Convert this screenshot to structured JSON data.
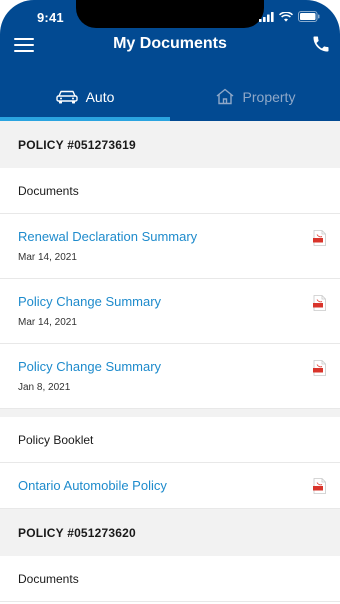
{
  "status": {
    "time": "9:41"
  },
  "header": {
    "title": "My Documents"
  },
  "tabs": [
    {
      "label": "Auto",
      "icon": "car-icon",
      "active": true
    },
    {
      "label": "Property",
      "icon": "house-icon",
      "active": false
    }
  ],
  "policies": [
    {
      "policy_label": "POLICY #051273619",
      "documents_heading": "Documents",
      "documents": [
        {
          "title": "Renewal Declaration Summary",
          "date": "Mar 14, 2021",
          "icon": "pdf-icon"
        },
        {
          "title": "Policy Change Summary",
          "date": "Mar 14, 2021",
          "icon": "pdf-icon"
        },
        {
          "title": "Policy Change Summary",
          "date": "Jan 8, 2021",
          "icon": "pdf-icon"
        }
      ],
      "booklet_heading": "Policy Booklet",
      "booklet": [
        {
          "title": "Ontario Automobile Policy",
          "icon": "pdf-icon"
        }
      ]
    },
    {
      "policy_label": "POLICY #051273620",
      "documents_heading": "Documents"
    }
  ],
  "colors": {
    "header": "#024a92",
    "link": "#1e8bcc",
    "tab_indicator": "#2aa4e0",
    "pdf_red": "#d9342b"
  }
}
